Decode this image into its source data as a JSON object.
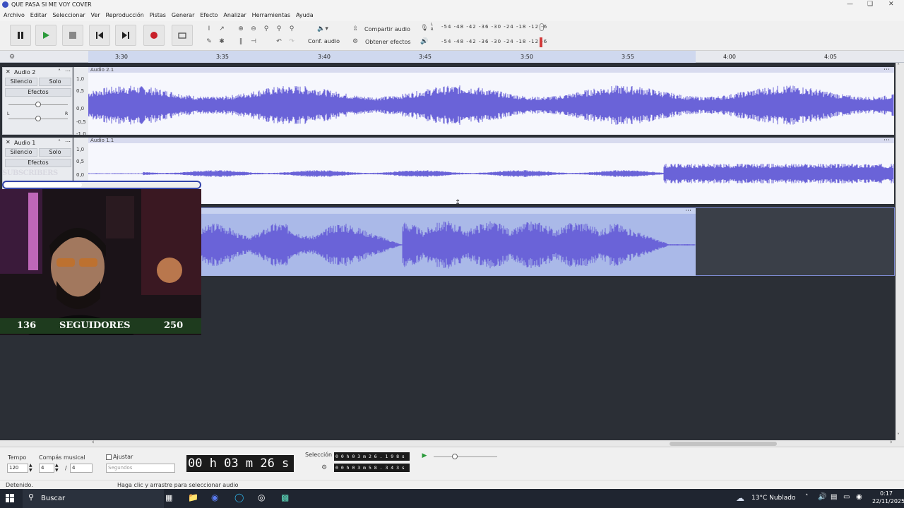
{
  "window": {
    "title": "QUE PASA SI ME VOY COVER"
  },
  "menu": [
    "Archivo",
    "Editar",
    "Seleccionar",
    "Ver",
    "Reproducción",
    "Pistas",
    "Generar",
    "Efecto",
    "Analizar",
    "Herramientas",
    "Ayuda"
  ],
  "toolbar": {
    "audio_setup": "Conf. audio",
    "share_audio": "Compartir audio",
    "get_effects": "Obtener efectos",
    "meter_scale": "-54 -48 -42 -36 -30 -24 -18 -12 -6",
    "rec_meter_l": "L",
    "rec_meter_r": "R"
  },
  "ruler": {
    "ticks": [
      "3:30",
      "3:35",
      "3:40",
      "3:45",
      "3:50",
      "3:55",
      "4:00",
      "4:05"
    ]
  },
  "tracks": [
    {
      "name": "Audio 2",
      "clip": "Audio 2.1",
      "mute": "Silencio",
      "solo": "Solo",
      "effects": "Efectos",
      "scale": [
        "1,0",
        "0,5",
        "0,0",
        "-0,5",
        "-1,0"
      ],
      "pan_l": "L",
      "pan_r": "R"
    },
    {
      "name": "Audio 1",
      "clip": "Audio 1.1",
      "mute": "Silencio",
      "solo": "Solo",
      "effects": "Efectos",
      "scale": [
        "1,0",
        "0,5",
        "0,0"
      ]
    }
  ],
  "overlay": {
    "subscribers_label": "SUBSCRIBERS",
    "followers_current": "136",
    "followers_label": "SEGUIDORES",
    "followers_goal": "250"
  },
  "bottom": {
    "tempo_label": "Tempo",
    "tempo_value": "120",
    "time_sig_label": "Compás musical",
    "time_sig_num": "4",
    "time_sig_sep": "/",
    "time_sig_den": "4",
    "snap_label": "Ajustar",
    "snap_unit": "Segundos",
    "big_time": "00 h 03 m 26 s",
    "selection_label": "Selección",
    "sel_start": "0 0 h 0 3 m 2 6 . 1 9 8 s",
    "sel_end": "0 0 h 0 3 m 5 8 . 3 4 3 s"
  },
  "status": {
    "state": "Detenido.",
    "hint": "Haga clic y arrastre para seleccionar audio"
  },
  "taskbar": {
    "search": "Buscar",
    "weather": "13°C  Nublado",
    "time": "0:17",
    "date": "22/11/2025"
  },
  "colors": {
    "wave": "#6a63d8",
    "selection": "#aab9e8",
    "track_bg": "#f6f7fd"
  }
}
